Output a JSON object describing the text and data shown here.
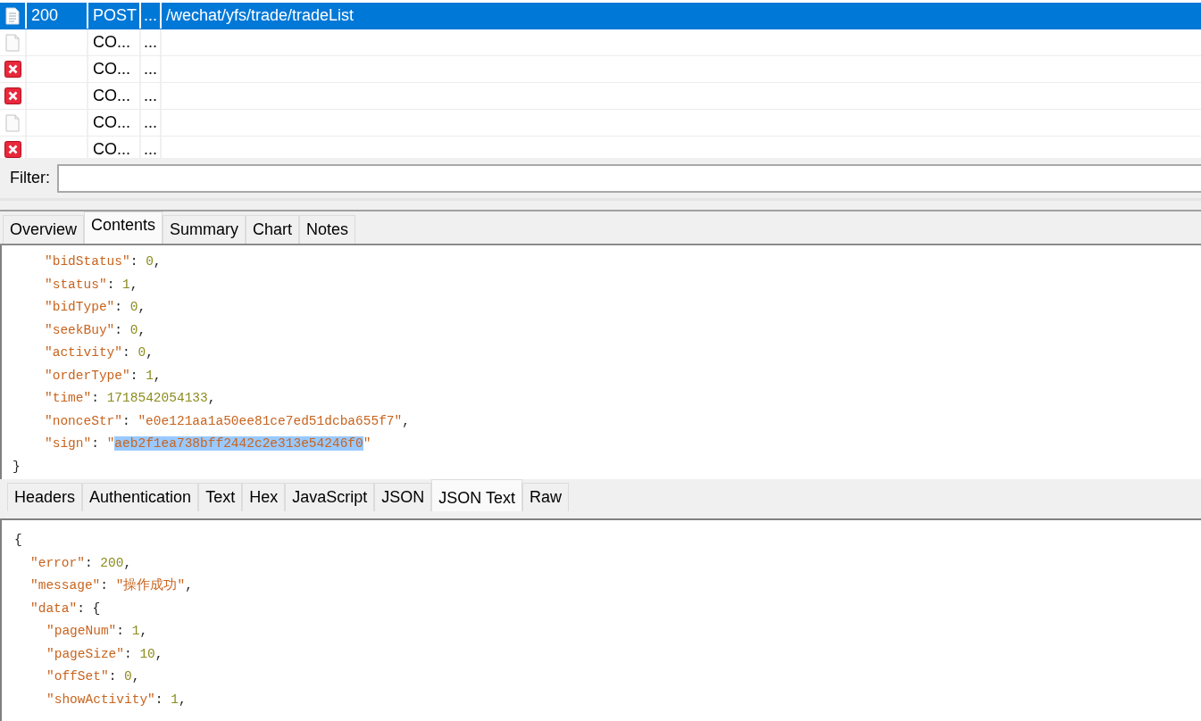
{
  "sessions": {
    "rows": [
      {
        "selected": true,
        "kind": "document",
        "result": "200",
        "protocol": "POST",
        "column_4": "...",
        "url": "/wechat/yfs/trade/tradeList"
      },
      {
        "selected": false,
        "kind": "blank",
        "protocol": "CO...",
        "column_4": "..."
      },
      {
        "selected": false,
        "kind": "error",
        "protocol": "CO...",
        "column_4": "..."
      },
      {
        "selected": false,
        "kind": "error",
        "protocol": "CO...",
        "column_4": "..."
      },
      {
        "selected": false,
        "kind": "blank",
        "protocol": "CO...",
        "column_4": "..."
      },
      {
        "selected": false,
        "kind": "error",
        "protocol": "CO...",
        "column_4": "..."
      }
    ]
  },
  "filter": {
    "label": "Filter:"
  },
  "request_tabs": [
    {
      "label": "Overview",
      "selected": false
    },
    {
      "label": "Contents",
      "selected": true
    },
    {
      "label": "Summary",
      "selected": false
    },
    {
      "label": "Chart",
      "selected": false
    },
    {
      "label": "Notes",
      "selected": false
    }
  ],
  "request_body": [
    {
      "children": [
        {
          "children": [
            {
              "tokens": [
                {
                  "kind": "key",
                  "text": "\"bidStatus\""
                },
                {
                  "kind": "punct",
                  "text": ": "
                },
                {
                  "kind": "number",
                  "text": "0"
                },
                {
                  "kind": "punct",
                  "text": ","
                }
              ]
            },
            {
              "tokens": [
                {
                  "kind": "key",
                  "text": "\"status\""
                },
                {
                  "kind": "punct",
                  "text": ": "
                },
                {
                  "kind": "number",
                  "text": "1"
                },
                {
                  "kind": "punct",
                  "text": ","
                }
              ]
            },
            {
              "tokens": [
                {
                  "kind": "key",
                  "text": "\"bidType\""
                },
                {
                  "kind": "punct",
                  "text": ": "
                },
                {
                  "kind": "number",
                  "text": "0"
                },
                {
                  "kind": "punct",
                  "text": ","
                }
              ]
            },
            {
              "tokens": [
                {
                  "kind": "key",
                  "text": "\"seekBuy\""
                },
                {
                  "kind": "punct",
                  "text": ": "
                },
                {
                  "kind": "number",
                  "text": "0"
                },
                {
                  "kind": "punct",
                  "text": ","
                }
              ]
            },
            {
              "tokens": [
                {
                  "kind": "key",
                  "text": "\"activity\""
                },
                {
                  "kind": "punct",
                  "text": ": "
                },
                {
                  "kind": "number",
                  "text": "0"
                },
                {
                  "kind": "punct",
                  "text": ","
                }
              ]
            },
            {
              "tokens": [
                {
                  "kind": "key",
                  "text": "\"orderType\""
                },
                {
                  "kind": "punct",
                  "text": ": "
                },
                {
                  "kind": "number",
                  "text": "1"
                },
                {
                  "kind": "punct",
                  "text": ","
                }
              ]
            },
            {
              "tokens": [
                {
                  "kind": "key",
                  "text": "\"time\""
                },
                {
                  "kind": "punct",
                  "text": ": "
                },
                {
                  "kind": "number",
                  "text": "1718542054133"
                },
                {
                  "kind": "punct",
                  "text": ","
                }
              ]
            },
            {
              "tokens": [
                {
                  "kind": "key",
                  "text": "\"nonceStr\""
                },
                {
                  "kind": "punct",
                  "text": ": "
                },
                {
                  "kind": "string",
                  "text": "\"e0e121aa1a50ee81ce7ed51dcba655f7\""
                },
                {
                  "kind": "punct",
                  "text": ","
                }
              ]
            },
            {
              "tokens": [
                {
                  "kind": "key",
                  "text": "\"sign\""
                },
                {
                  "kind": "punct",
                  "text": ": "
                },
                {
                  "kind": "string",
                  "text": "\""
                },
                {
                  "kind": "selection",
                  "text": "aeb2f1ea738bff2442c2e313e54246f0"
                },
                {
                  "kind": "string",
                  "text": "\""
                }
              ]
            }
          ]
        }
      ]
    },
    {
      "tokens": [
        {
          "kind": "punct",
          "text": "}"
        }
      ]
    }
  ],
  "response_tabs": [
    {
      "label": "Headers",
      "selected": false
    },
    {
      "label": "Authentication",
      "selected": false
    },
    {
      "label": "Text",
      "selected": false
    },
    {
      "label": "Hex",
      "selected": false
    },
    {
      "label": "JavaScript",
      "selected": false
    },
    {
      "label": "JSON",
      "selected": false
    },
    {
      "label": "JSON Text",
      "selected": true
    },
    {
      "label": "Raw",
      "selected": false
    }
  ],
  "response_body": [
    {
      "tokens": [
        {
          "kind": "punct",
          "text": "{"
        }
      ],
      "children": [
        {
          "tokens": [
            {
              "kind": "key",
              "text": "\"error\""
            },
            {
              "kind": "punct",
              "text": ": "
            },
            {
              "kind": "number",
              "text": "200"
            },
            {
              "kind": "punct",
              "text": ","
            }
          ]
        },
        {
          "tokens": [
            {
              "kind": "key",
              "text": "\"message\""
            },
            {
              "kind": "punct",
              "text": ": "
            },
            {
              "kind": "string",
              "text": "\"操作成功\""
            },
            {
              "kind": "punct",
              "text": ","
            }
          ]
        },
        {
          "tokens": [
            {
              "kind": "key",
              "text": "\"data\""
            },
            {
              "kind": "punct",
              "text": ": {"
            }
          ],
          "children": [
            {
              "tokens": [
                {
                  "kind": "key",
                  "text": "\"pageNum\""
                },
                {
                  "kind": "punct",
                  "text": ": "
                },
                {
                  "kind": "number",
                  "text": "1"
                },
                {
                  "kind": "punct",
                  "text": ","
                }
              ]
            },
            {
              "tokens": [
                {
                  "kind": "key",
                  "text": "\"pageSize\""
                },
                {
                  "kind": "punct",
                  "text": ": "
                },
                {
                  "kind": "number",
                  "text": "10"
                },
                {
                  "kind": "punct",
                  "text": ","
                }
              ]
            },
            {
              "tokens": [
                {
                  "kind": "key",
                  "text": "\"offSet\""
                },
                {
                  "kind": "punct",
                  "text": ": "
                },
                {
                  "kind": "number",
                  "text": "0"
                },
                {
                  "kind": "punct",
                  "text": ","
                }
              ]
            },
            {
              "tokens": [
                {
                  "kind": "key",
                  "text": "\"showActivity\""
                },
                {
                  "kind": "punct",
                  "text": ": "
                },
                {
                  "kind": "number",
                  "text": "1"
                },
                {
                  "kind": "punct",
                  "text": ","
                }
              ]
            }
          ]
        }
      ]
    }
  ]
}
